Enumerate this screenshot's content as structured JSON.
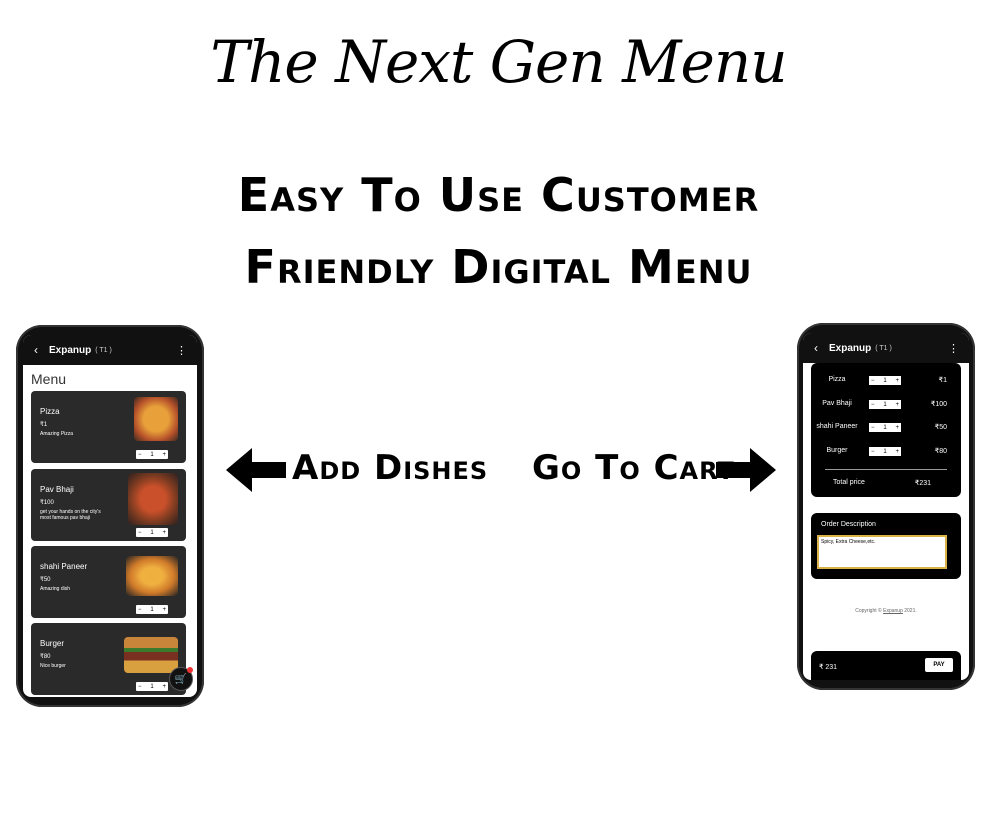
{
  "title": "The Next Gen Menu",
  "headline": {
    "line1": "Easy To Use Customer",
    "line2": "Friendly Digital Menu"
  },
  "labels": {
    "add_dishes": "Add Dishes",
    "go_to_cart": "Go To Cart"
  },
  "menu_phone": {
    "app_title": "Expanup",
    "table": "( T1 )",
    "back_icon": "chevron-left-icon",
    "more_icon": "more-vert-icon",
    "menu_heading": "Menu",
    "dishes": [
      {
        "name": "Pizza",
        "price": "₹1",
        "desc": "Amazing Pizza",
        "qty": "1",
        "color": "#c9652a"
      },
      {
        "name": "Pav Bhaji",
        "price": "₹100",
        "desc": "get your hands on the city's most famous pav bhaji",
        "qty": "1",
        "color": "#a8432a"
      },
      {
        "name": "shahi Paneer",
        "price": "₹50",
        "desc": "Amazing dish",
        "qty": "1",
        "color": "#d68a2e"
      },
      {
        "name": "Burger",
        "price": "₹80",
        "desc": "Nice burger",
        "qty": "1",
        "color": "#8a5a2e"
      }
    ],
    "cart_icon": "cart-icon"
  },
  "cart_phone": {
    "app_title": "Expanup",
    "table": "( T1 )",
    "items": [
      {
        "name": "Pizza",
        "qty": "1",
        "price": "₹1"
      },
      {
        "name": "Pav Bhaji",
        "qty": "1",
        "price": "₹100"
      },
      {
        "name": "shahi Paneer",
        "qty": "1",
        "price": "₹50"
      },
      {
        "name": "Burger",
        "qty": "1",
        "price": "₹80"
      }
    ],
    "total_label": "Total price",
    "total_value": "₹231",
    "order_desc_label": "Order Description",
    "order_desc_value": "Spicy, Extra Cheese,etc.",
    "copyright_prefix": "Copyright ©",
    "copyright_brand": "Expanup",
    "copyright_year": "2021.",
    "pay_total": "₹ 231",
    "pay_button": "PAY"
  }
}
